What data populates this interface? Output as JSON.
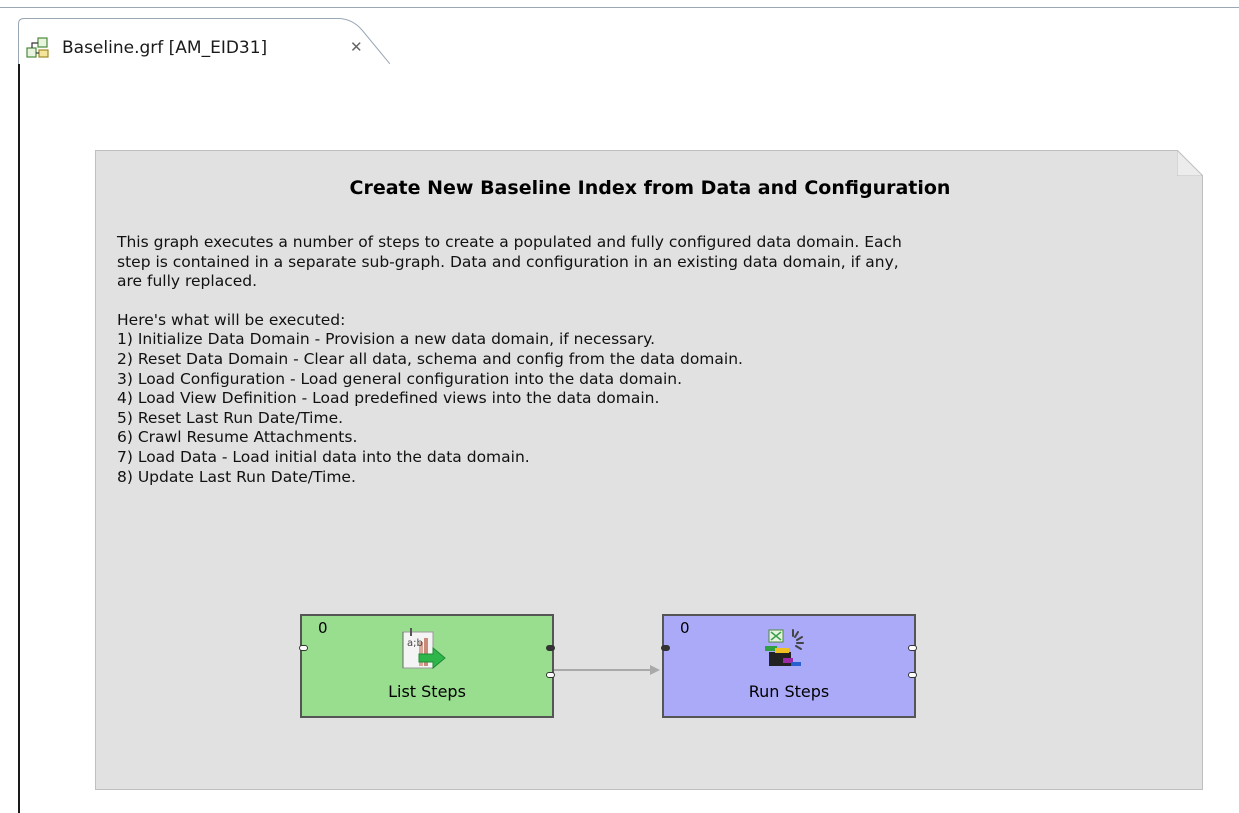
{
  "tab": {
    "title": "Baseline.grf [AM_EID31]",
    "close_glyph": "✕",
    "icon": "graph-file-icon"
  },
  "note": {
    "title": "Create New Baseline Index from Data and Configuration",
    "description_lines": [
      "This graph executes a number of steps to create a populated and fully configured data domain. Each",
      "step is contained in a separate sub-graph. Data and configuration in an existing data domain, if any,",
      "are fully replaced."
    ],
    "steps_heading": "Here's what will be executed:",
    "steps": [
      "1) Initialize Data Domain - Provision a new data domain, if necessary.",
      "2) Reset Data Domain - Clear all data, schema and config from the data domain.",
      "3) Load Configuration - Load general configuration into the data domain.",
      "4) Load View Definition - Load predefined views into the data domain.",
      "5) Reset Last Run Date/Time.",
      "6) Crawl Resume Attachments.",
      "7) Load Data - Load initial data into the data domain.",
      "8) Update Last Run Date/Time."
    ]
  },
  "components": {
    "list_steps": {
      "label": "List Steps",
      "count": "0",
      "color": "#99dd8f",
      "icon": "list-steps-icon"
    },
    "run_steps": {
      "label": "Run Steps",
      "count": "0",
      "color": "#aaaaf8",
      "icon": "run-steps-icon"
    }
  }
}
